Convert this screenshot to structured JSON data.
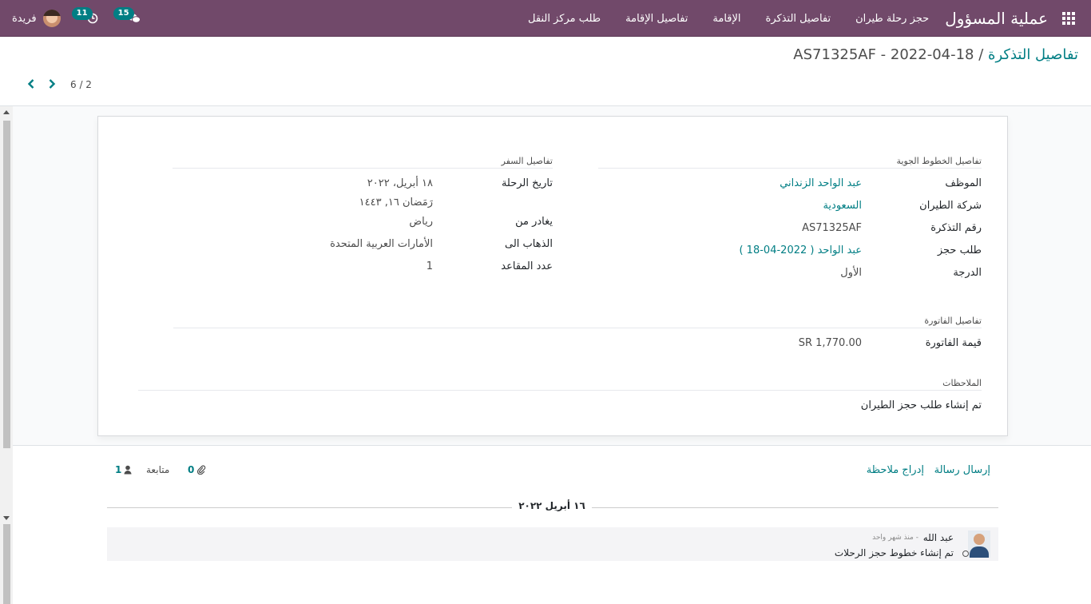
{
  "navbar": {
    "app_title": "عملية المسؤول",
    "menu": [
      "حجز رحلة طيران",
      "تفاصيل التذكرة",
      "الإقامة",
      "تفاصيل الإقامة",
      "طلب مركز النقل"
    ],
    "messages_count": "15",
    "activities_count": "11",
    "user_name": "فريدة"
  },
  "breadcrumb": {
    "parent": "تفاصيل التذكرة",
    "separator": " / ",
    "current": "AS71325AF - 2022-04-18"
  },
  "pager": {
    "value": "6 / 2"
  },
  "form": {
    "airline_section": {
      "title": "تفاصيل الخطوط الجوية",
      "fields": [
        {
          "label": "الموظف",
          "value": "عبد الواحد الزنداني",
          "link": true
        },
        {
          "label": "شركة الطيران",
          "value": "السعودية",
          "link": true
        },
        {
          "label": "رقم التذكرة",
          "value": "AS71325AF",
          "link": false
        },
        {
          "label": "طلب حجز",
          "value": "عبد الواحد ( 2022-04-18 )",
          "link": true
        },
        {
          "label": "الدرجة",
          "value": "الأول",
          "link": false
        }
      ]
    },
    "travel_section": {
      "title": "تفاصيل السفر",
      "trip_date_label": "تاريخ الرحلة",
      "trip_date": "١٨ أبريل، ٢٠٢٢",
      "trip_date_hijri": "رَمَضان ١٦, ١٤٤٣",
      "from_label": "يغادر من",
      "from_value": "رياض",
      "to_label": "الذهاب الى",
      "to_value": "الأمارات العربية المتحدة",
      "seats_label": "عدد المقاعد",
      "seats_value": "1"
    },
    "invoice_section": {
      "title": "تفاصيل الفاتورة",
      "amount_label": "قيمة الفاتورة",
      "amount_value": "SR 1,770.00"
    },
    "notes_section": {
      "title": "الملاحظات",
      "text": "تم إنشاء طلب حجز الطيران"
    }
  },
  "chatter": {
    "send_message": "إرسال رسالة",
    "log_note": "إدراج ملاحظة",
    "attachments_count": "0",
    "follow_label": "متابعة",
    "followers_count": "1",
    "date_separator": "١٦ أبريل ٢٠٢٢",
    "message": {
      "author": "عبد الله",
      "time": "- منذ شهر واحد",
      "body": "تم إنشاء خطوط حجز الرحلات"
    }
  },
  "colors": {
    "brand": "#71496a",
    "accent": "#017e84"
  }
}
